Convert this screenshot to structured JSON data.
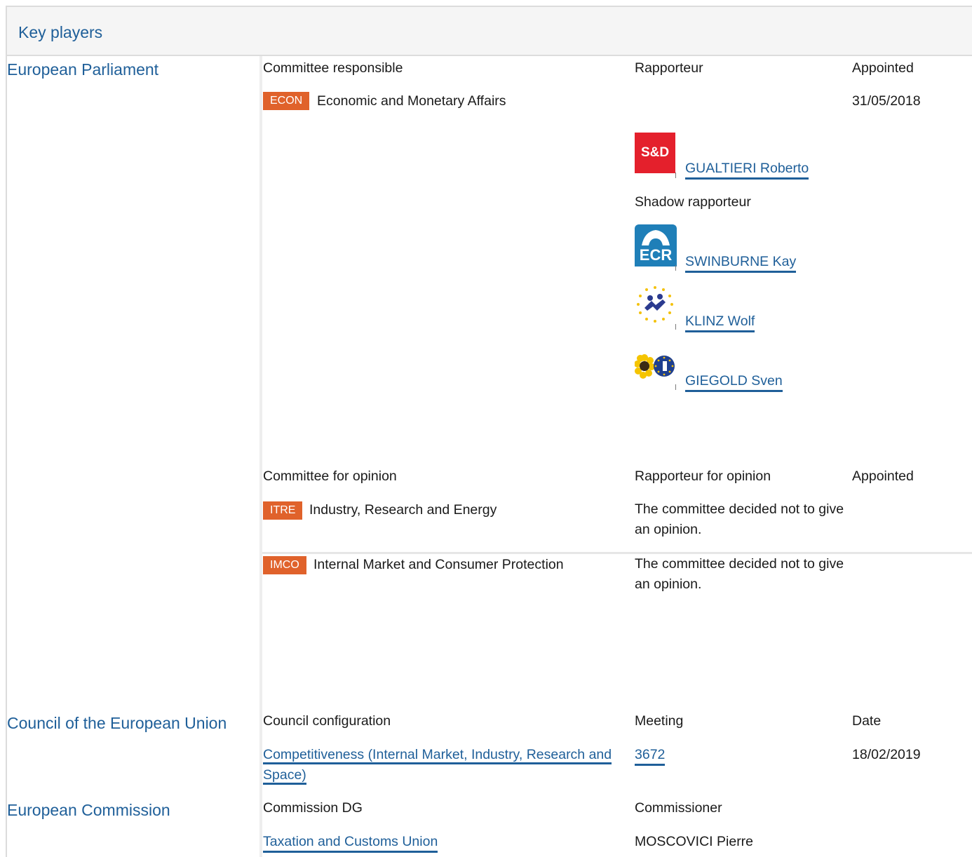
{
  "header": {
    "title": "Key players"
  },
  "parliament": {
    "name": "European Parliament",
    "responsible": {
      "col_committee": "Committee responsible",
      "col_rapporteur": "Rapporteur",
      "col_appointed": "Appointed",
      "committee_code": "ECON",
      "committee_name": "Economic and Monetary Affairs",
      "appointed": "31/05/2018",
      "rapporteur": {
        "group": "S&D",
        "name": "GUALTIERI Roberto"
      },
      "shadow_label": "Shadow rapporteur",
      "shadows": [
        {
          "group_icon": "ecr-logo-icon",
          "group_text": "ECR",
          "name": "SWINBURNE Kay"
        },
        {
          "group_icon": "alde-logo-icon",
          "name": "KLINZ Wolf"
        },
        {
          "group_icon": "greens-efa-logo-icon",
          "name": "GIEGOLD Sven"
        }
      ]
    },
    "opinion": {
      "col_committee": "Committee for opinion",
      "col_rapporteur": "Rapporteur for opinion",
      "col_appointed": "Appointed",
      "rows": [
        {
          "code": "ITRE",
          "name": "Industry, Research and Energy",
          "note": "The committee decided not to give an opinion."
        },
        {
          "code": "IMCO",
          "name": "Internal Market and Consumer Protection",
          "note": "The committee decided not to give an opinion."
        }
      ]
    }
  },
  "council": {
    "name": "Council of the European Union",
    "col_config": "Council configuration",
    "col_meeting": "Meeting",
    "col_date": "Date",
    "configuration": "Competitiveness (Internal Market, Industry, Research and Space)",
    "meeting": "3672",
    "date": "18/02/2019"
  },
  "commission": {
    "name": "European Commission",
    "col_dg": "Commission DG",
    "col_commissioner": "Commissioner",
    "dg": "Taxation and Customs Union",
    "commissioner": "MOSCOVICI Pierre"
  },
  "colors": {
    "link": "#1f5f99",
    "badge": "#e0622b",
    "header_bg": "#f5f5f5"
  }
}
